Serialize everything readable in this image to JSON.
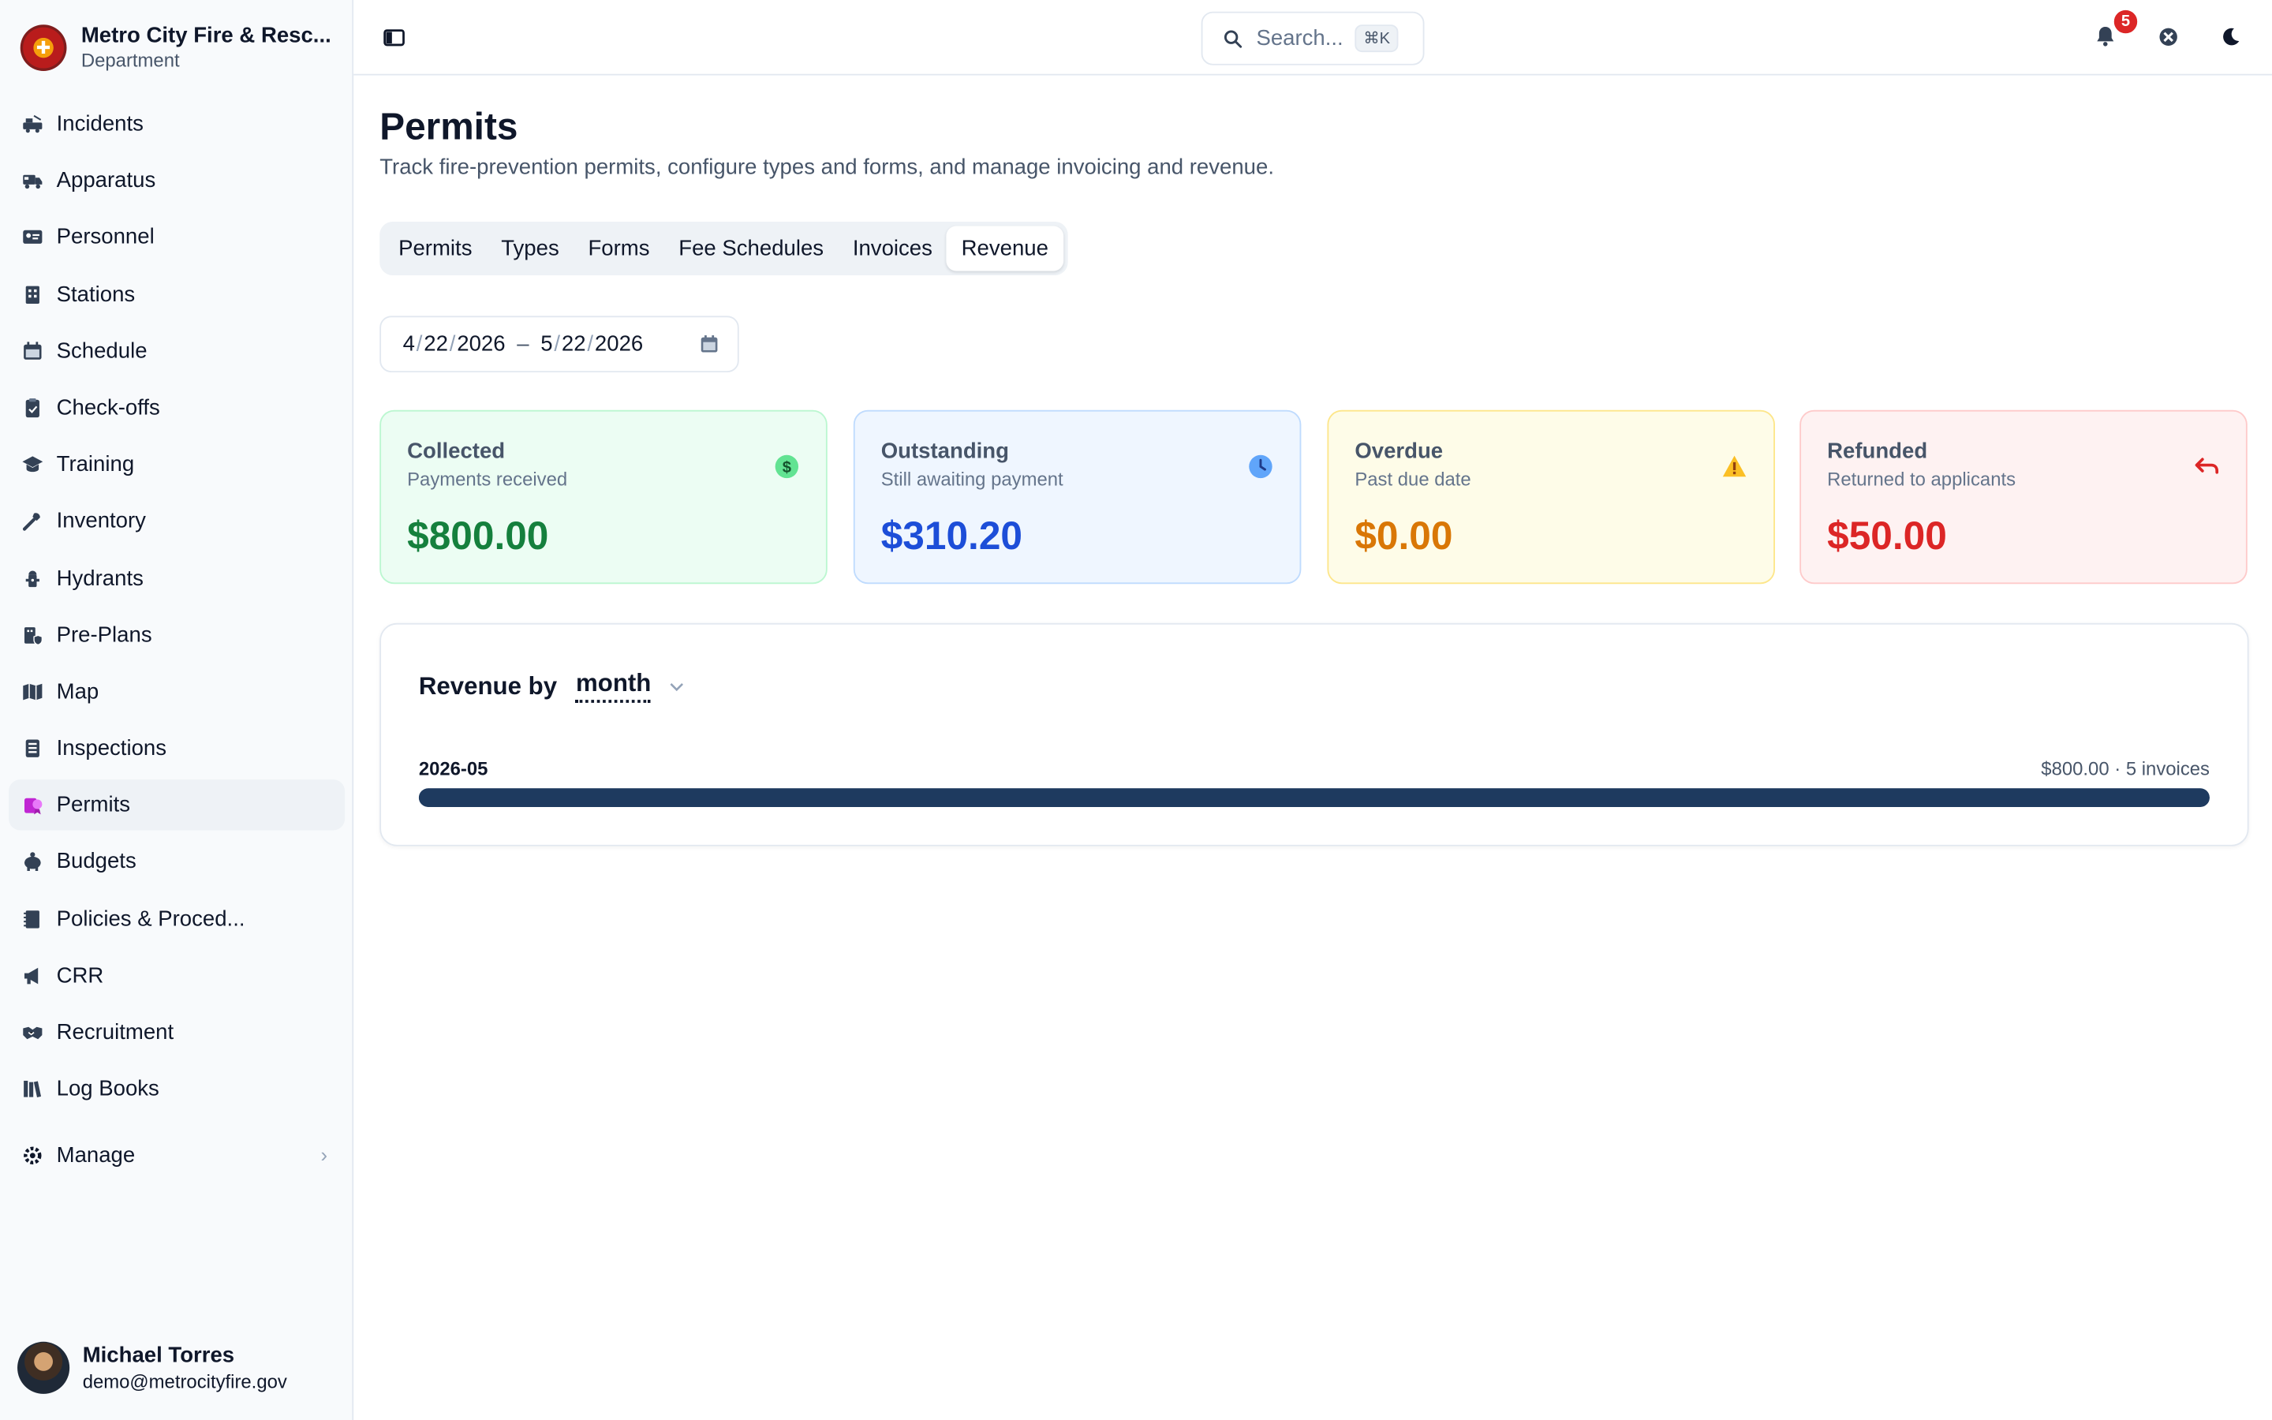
{
  "org": {
    "name": "Metro City Fire & Resc...",
    "sub": "Department"
  },
  "nav": [
    {
      "label": "Incidents",
      "icon": "fire-truck-icon"
    },
    {
      "label": "Apparatus",
      "icon": "truck-icon"
    },
    {
      "label": "Personnel",
      "icon": "id-card-icon"
    },
    {
      "label": "Stations",
      "icon": "building-icon"
    },
    {
      "label": "Schedule",
      "icon": "calendar-icon"
    },
    {
      "label": "Check-offs",
      "icon": "clipboard-icon"
    },
    {
      "label": "Training",
      "icon": "graduation-cap-icon"
    },
    {
      "label": "Inventory",
      "icon": "tools-icon"
    },
    {
      "label": "Hydrants",
      "icon": "hydrant-icon"
    },
    {
      "label": "Pre-Plans",
      "icon": "building-shield-icon"
    },
    {
      "label": "Map",
      "icon": "map-icon"
    },
    {
      "label": "Inspections",
      "icon": "checklist-icon"
    },
    {
      "label": "Permits",
      "icon": "permit-icon",
      "active": true
    },
    {
      "label": "Budgets",
      "icon": "piggy-bank-icon"
    },
    {
      "label": "Policies & Proced...",
      "icon": "book-icon"
    },
    {
      "label": "CRR",
      "icon": "megaphone-icon"
    },
    {
      "label": "Recruitment",
      "icon": "handshake-icon"
    },
    {
      "label": "Log Books",
      "icon": "books-icon"
    }
  ],
  "manage": {
    "label": "Manage"
  },
  "user": {
    "name": "Michael Torres",
    "email": "demo@metrocityfire.gov"
  },
  "topbar": {
    "search_label": "Search...",
    "shortcut": "⌘K",
    "notification_count": "5"
  },
  "page": {
    "title": "Permits",
    "subtitle": "Track fire-prevention permits, configure types and forms, and manage invoicing and revenue."
  },
  "tabs": [
    {
      "label": "Permits"
    },
    {
      "label": "Types"
    },
    {
      "label": "Forms"
    },
    {
      "label": "Fee Schedules"
    },
    {
      "label": "Invoices"
    },
    {
      "label": "Revenue",
      "active": true
    }
  ],
  "date_range": {
    "from": {
      "m": "4",
      "d": "22",
      "y": "2026"
    },
    "to": {
      "m": "5",
      "d": "22",
      "y": "2026"
    },
    "sep": "/",
    "dash": "–"
  },
  "cards": [
    {
      "title": "Collected",
      "desc": "Payments received",
      "value": "$800.00",
      "icon": "dollar-icon",
      "bg": "#ecfdf3",
      "border": "#bbf7d0",
      "color": "#15803d"
    },
    {
      "title": "Outstanding",
      "desc": "Still awaiting payment",
      "value": "$310.20",
      "icon": "clock-icon",
      "bg": "#eff6ff",
      "border": "#bfdbfe",
      "color": "#1d4ed8"
    },
    {
      "title": "Overdue",
      "desc": "Past due date",
      "value": "$0.00",
      "icon": "warning-icon",
      "bg": "#fefce8",
      "border": "#fde68a",
      "color": "#d97706"
    },
    {
      "title": "Refunded",
      "desc": "Returned to applicants",
      "value": "$50.00",
      "icon": "undo-arrow-icon",
      "bg": "#fef2f2",
      "border": "#fecaca",
      "color": "#dc2626"
    }
  ],
  "revenue": {
    "heading": "Revenue by",
    "group_by": "month",
    "rows": [
      {
        "period": "2026-05",
        "summary": "$800.00 · 5 invoices",
        "fraction": 1.0
      }
    ],
    "bar_color": "#1e3a5f"
  }
}
